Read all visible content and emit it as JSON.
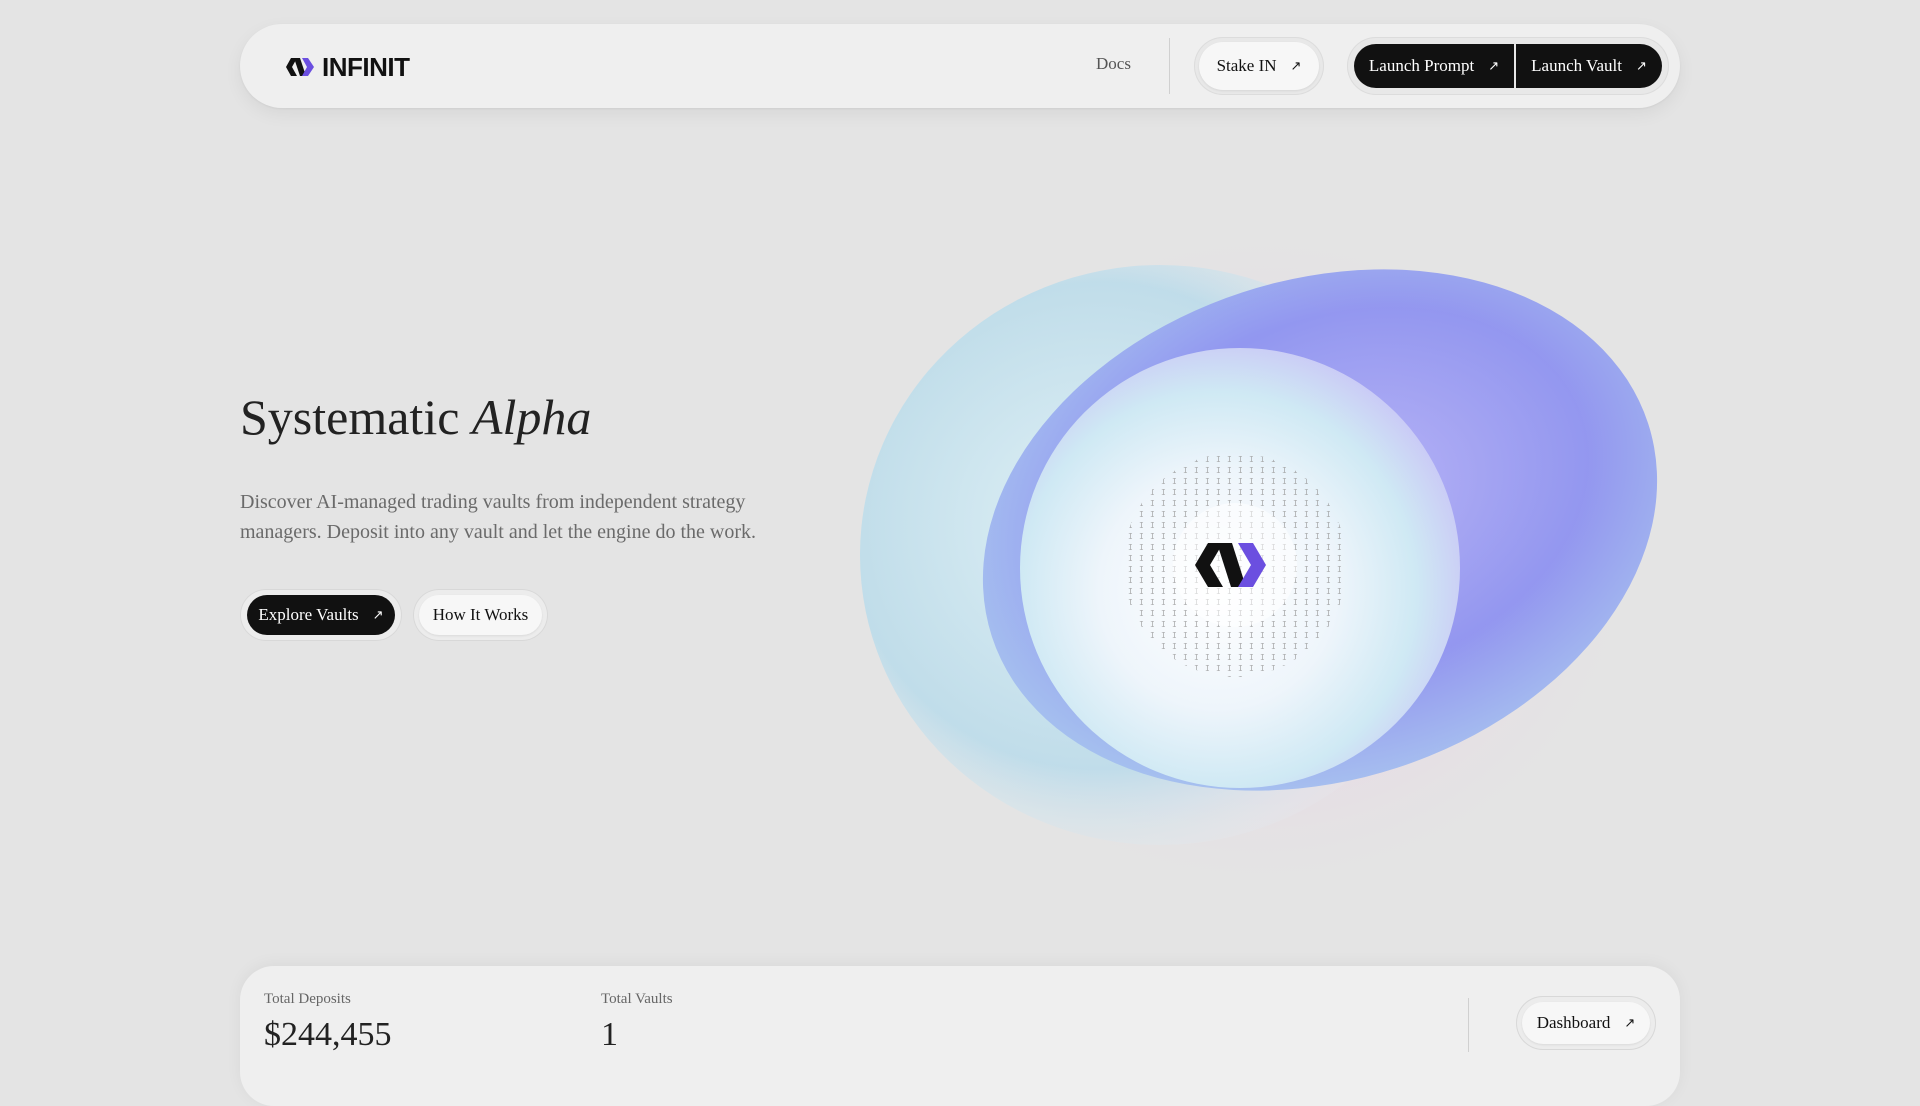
{
  "header": {
    "logo_text": "INFINIT",
    "docs_label": "Docs",
    "stake_label": "Stake IN",
    "launch_prompt_label": "Launch Prompt",
    "launch_vault_label": "Launch Vault",
    "arrow_icon": "arrow-up-right-icon"
  },
  "hero": {
    "title_regular": "Systematic",
    "title_italic": "Alpha",
    "description": "Discover AI-managed trading vaults from independent strategy managers. Deposit into any vault and let the engine do the work.",
    "explore_label": "Explore Vaults",
    "how_label": "How It Works"
  },
  "stats": {
    "total_deposits_label": "Total Deposits",
    "total_deposits_value": "$244,455",
    "total_vaults_label": "Total Vaults",
    "total_vaults_value": "1",
    "dashboard_label": "Dashboard"
  },
  "colors": {
    "brand_purple": "#6b4fe0",
    "dark_button": "#111111",
    "background": "#e4e4e4"
  }
}
